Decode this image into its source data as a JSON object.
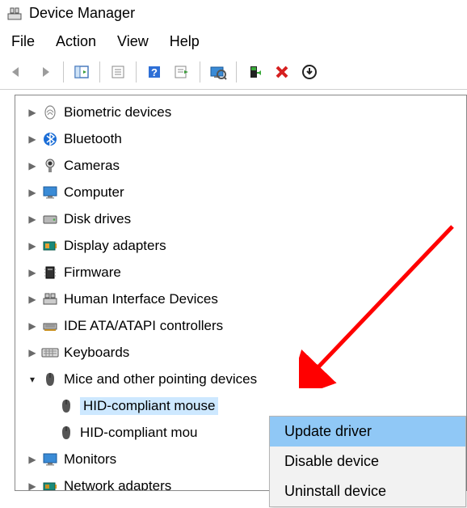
{
  "window": {
    "title": "Device Manager"
  },
  "menu": {
    "file": "File",
    "action": "Action",
    "view": "View",
    "help": "Help"
  },
  "tree": {
    "items": [
      {
        "label": "Biometric devices"
      },
      {
        "label": "Bluetooth"
      },
      {
        "label": "Cameras"
      },
      {
        "label": "Computer"
      },
      {
        "label": "Disk drives"
      },
      {
        "label": "Display adapters"
      },
      {
        "label": "Firmware"
      },
      {
        "label": "Human Interface Devices"
      },
      {
        "label": "IDE ATA/ATAPI controllers"
      },
      {
        "label": "Keyboards"
      },
      {
        "label": "Mice and other pointing devices"
      },
      {
        "label": "HID-compliant mouse"
      },
      {
        "label": "HID-compliant mou"
      },
      {
        "label": "Monitors"
      },
      {
        "label": "Network adapters"
      }
    ]
  },
  "context_menu": {
    "update": "Update driver",
    "disable": "Disable device",
    "uninstall": "Uninstall device"
  }
}
